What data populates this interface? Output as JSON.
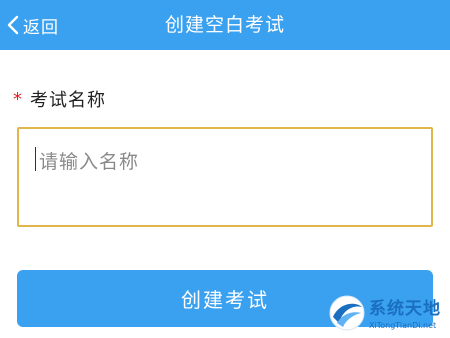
{
  "header": {
    "back_label": "返回",
    "title": "创建空白考试"
  },
  "form": {
    "required_mark": "*",
    "exam_name_label": "考试名称",
    "exam_name_placeholder": "请输入名称",
    "exam_name_value": ""
  },
  "actions": {
    "create_label": "创建考试"
  },
  "watermark": {
    "site_name": "系统天地",
    "site_url": "XiTongTianDi.net"
  },
  "colors": {
    "brand_blue": "#3aa1f0",
    "input_border": "#e0b54a",
    "required_red": "#e02020"
  },
  "icons": {
    "back": "chevron-left-icon",
    "watermark_logo": "site-logo-icon"
  }
}
